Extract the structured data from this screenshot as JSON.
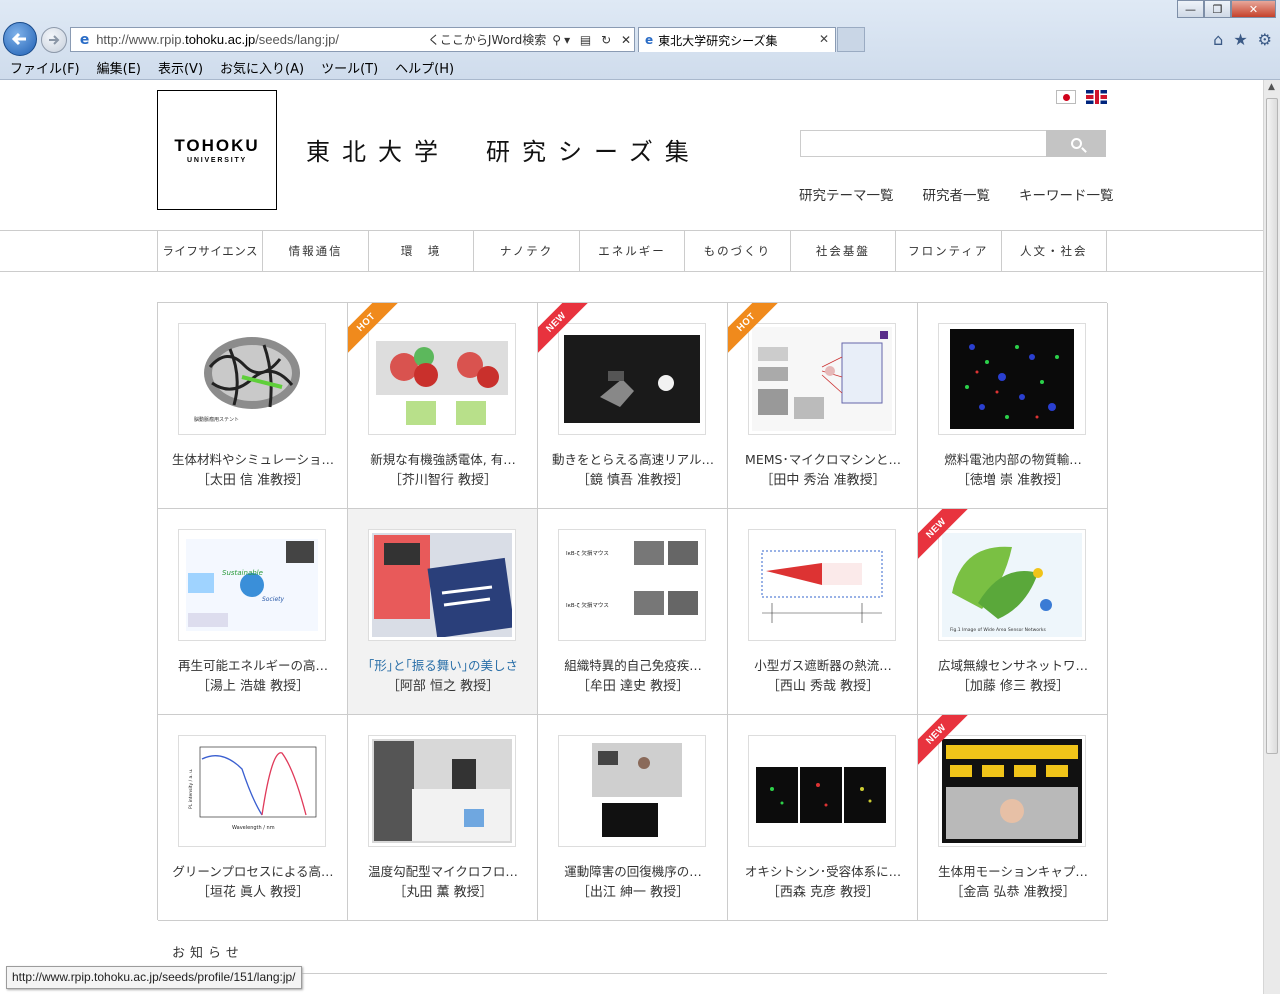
{
  "browser": {
    "url_prefix": "http://www.rpip.",
    "url_domain": "tohoku.ac.jp",
    "url_suffix": "/seeds/lang:jp/",
    "search_placeholder": "くここからJWord検索",
    "tab_title": "東北大学研究シーズ集",
    "menu": [
      "ファイル(F)",
      "編集(E)",
      "表示(V)",
      "お気に入り(A)",
      "ツール(T)",
      "ヘルプ(H)"
    ],
    "status_url": "http://www.rpip.tohoku.ac.jp/seeds/profile/151/lang:jp/"
  },
  "header": {
    "logo_line1": "TOHOKU",
    "logo_line2": "UNIVERSITY",
    "title": "東北大学　研究シーズ集",
    "links": [
      "研究テーマ一覧",
      "研究者一覧",
      "キーワード一覧"
    ]
  },
  "categories": [
    "ライフサイエンス",
    "情報通信",
    "環　境",
    "ナノテク",
    "エネルギー",
    "ものづくり",
    "社会基盤",
    "フロンティア",
    "人文・社会"
  ],
  "cards": [
    {
      "title": "生体材料やシミュレーショ…",
      "prof": "［太田 信 准教授］",
      "badge": "",
      "icon": "stent-image"
    },
    {
      "title": "新規な有機強誘電体, 有…",
      "prof": "［芥川智行 教授］",
      "badge": "HOT",
      "icon": "molecule-image"
    },
    {
      "title": "動きをとらえる高速リアル…",
      "prof": "［鏡 慎吾 准教授］",
      "badge": "NEW",
      "icon": "camera-image"
    },
    {
      "title": "MEMS･マイクロマシンと…",
      "prof": "［田中 秀治 准教授］",
      "badge": "HOT",
      "icon": "mems-image"
    },
    {
      "title": "燃料電池内部の物質輸…",
      "prof": "［徳増 崇 准教授］",
      "badge": "",
      "icon": "simulation-image"
    },
    {
      "title": "再生可能エネルギーの高…",
      "prof": "［湯上 浩雄 教授］",
      "badge": "",
      "icon": "energy-image"
    },
    {
      "title": "｢形｣と｢振る舞い｣の美しさ",
      "prof": "［阿部 恒之 教授］",
      "badge": "",
      "icon": "book-image"
    },
    {
      "title": "組織特異的自己免疫疾…",
      "prof": "［牟田 達史 教授］",
      "badge": "",
      "icon": "mouse-image"
    },
    {
      "title": "小型ガス遮断器の熱流…",
      "prof": "［西山 秀哉 教授］",
      "badge": "",
      "icon": "breaker-image"
    },
    {
      "title": "広域無線センサネットワ…",
      "prof": "［加藤 修三 教授］",
      "badge": "NEW",
      "icon": "sensor-image"
    },
    {
      "title": "グリーンプロセスによる高…",
      "prof": "［垣花 眞人 教授］",
      "badge": "",
      "icon": "spectrum-image"
    },
    {
      "title": "温度勾配型マイクロフロ…",
      "prof": "［丸田 薫 教授］",
      "badge": "",
      "icon": "device-image"
    },
    {
      "title": "運動障害の回復機序の…",
      "prof": "［出江 紳一 教授］",
      "badge": "",
      "icon": "rehab-image"
    },
    {
      "title": "オキシトシン･受容体系に…",
      "prof": "［西森 克彦 教授］",
      "badge": "",
      "icon": "neuron-image"
    },
    {
      "title": "生体用モーションキャプ…",
      "prof": "［金高 弘恭 准教授］",
      "badge": "NEW",
      "icon": "motion-image"
    }
  ],
  "thumb_texts": {
    "stent": "脳動脈瘤用ステント",
    "sustainable": "Sustainable",
    "society": "Society",
    "mouse1": "IκB-ζ 欠損マウス",
    "mouse2": "IκB-ζ 欠損マウス",
    "xaxis": "Wavelength / nm",
    "yaxis": "PL intensity / a. u.",
    "sensor_cap": "Fig.1 Image of Wide Area Sensor Networks"
  },
  "news": "お知らせ",
  "colors": {
    "hot": "#f08a1c",
    "new": "#e8333e",
    "link": "#2a6fa8"
  }
}
